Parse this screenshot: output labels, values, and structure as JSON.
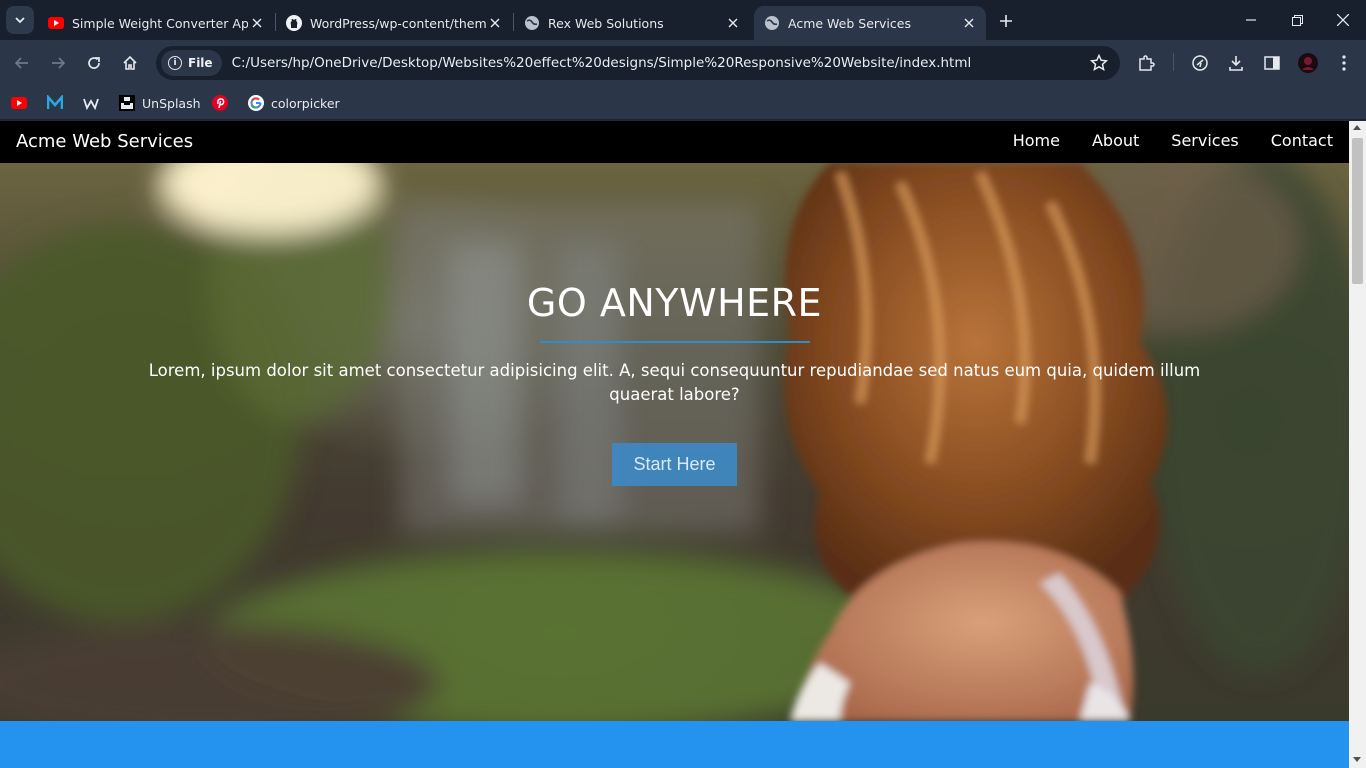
{
  "browser": {
    "tabs": [
      {
        "title": "Simple Weight Converter App W",
        "icon": "youtube-icon",
        "active": false
      },
      {
        "title": "WordPress/wp-content/themes",
        "icon": "github-icon",
        "active": false
      },
      {
        "title": "Rex Web Solutions",
        "icon": "globe-icon",
        "active": false
      },
      {
        "title": "Acme Web Services",
        "icon": "globe-icon",
        "active": true
      }
    ],
    "address": {
      "scheme_chip": "File",
      "url": "C:/Users/hp/OneDrive/Desktop/Websites%20effect%20designs/Simple%20Responsive%20Website/index.html"
    },
    "bookmarks": [
      {
        "label": "",
        "icon": "youtube-icon"
      },
      {
        "label": "",
        "icon": "medium-m-icon"
      },
      {
        "label": "",
        "icon": "webflow-icon"
      },
      {
        "label": "UnSplash",
        "icon": "unsplash-icon"
      },
      {
        "label": "",
        "icon": "pinterest-icon"
      },
      {
        "label": "colorpicker",
        "icon": "google-icon"
      }
    ],
    "colors": {
      "chrome_dark": "#17202c",
      "chrome_toolbar": "#2b3748"
    }
  },
  "site": {
    "brand": "Acme Web Services",
    "nav": [
      "Home",
      "About",
      "Services",
      "Contact"
    ],
    "hero": {
      "title": "GO ANYWHERE",
      "text": "Lorem, ipsum dolor sit amet consectetur adipisicing elit. A, sequi consequuntur repudiandae sed natus eum quia, quidem illum quaerat labore?",
      "button": "Start Here"
    },
    "colors": {
      "accent": "#2393ef",
      "rule": "#2f8ec9",
      "nav_bg": "#000000"
    }
  }
}
